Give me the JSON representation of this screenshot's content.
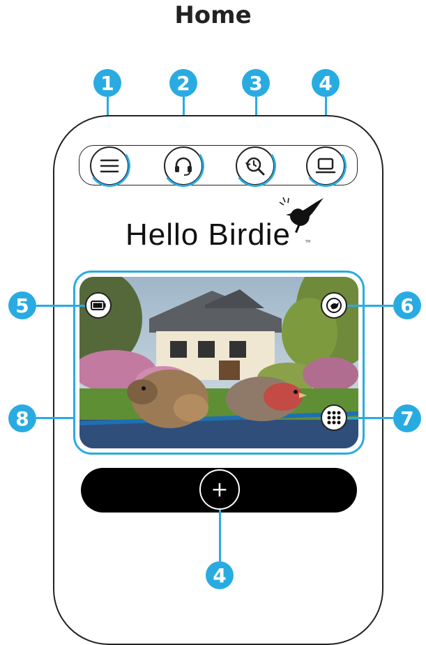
{
  "page": {
    "title": "Home"
  },
  "callouts": {
    "n1": "1",
    "n2": "2",
    "n3": "3",
    "n4_top": "4",
    "n5": "5",
    "n6": "6",
    "n7": "7",
    "n8": "8",
    "n4_bottom": "4"
  },
  "app": {
    "logo_text": "Hello Birdie",
    "trademark": "TM"
  },
  "toolbar": {
    "buttons": [
      {
        "icon": "menu-icon"
      },
      {
        "icon": "headset-icon"
      },
      {
        "icon": "history-icon"
      },
      {
        "icon": "laptop-icon"
      }
    ]
  },
  "camera": {
    "top_left_icon": "battery-icon",
    "top_right_icon": "bird-capture-icon",
    "bottom_right_icon": "grid-menu-icon"
  },
  "bottom_bar": {
    "add_label": "+"
  },
  "colors": {
    "accent": "#29abe2",
    "dark": "#222222"
  }
}
